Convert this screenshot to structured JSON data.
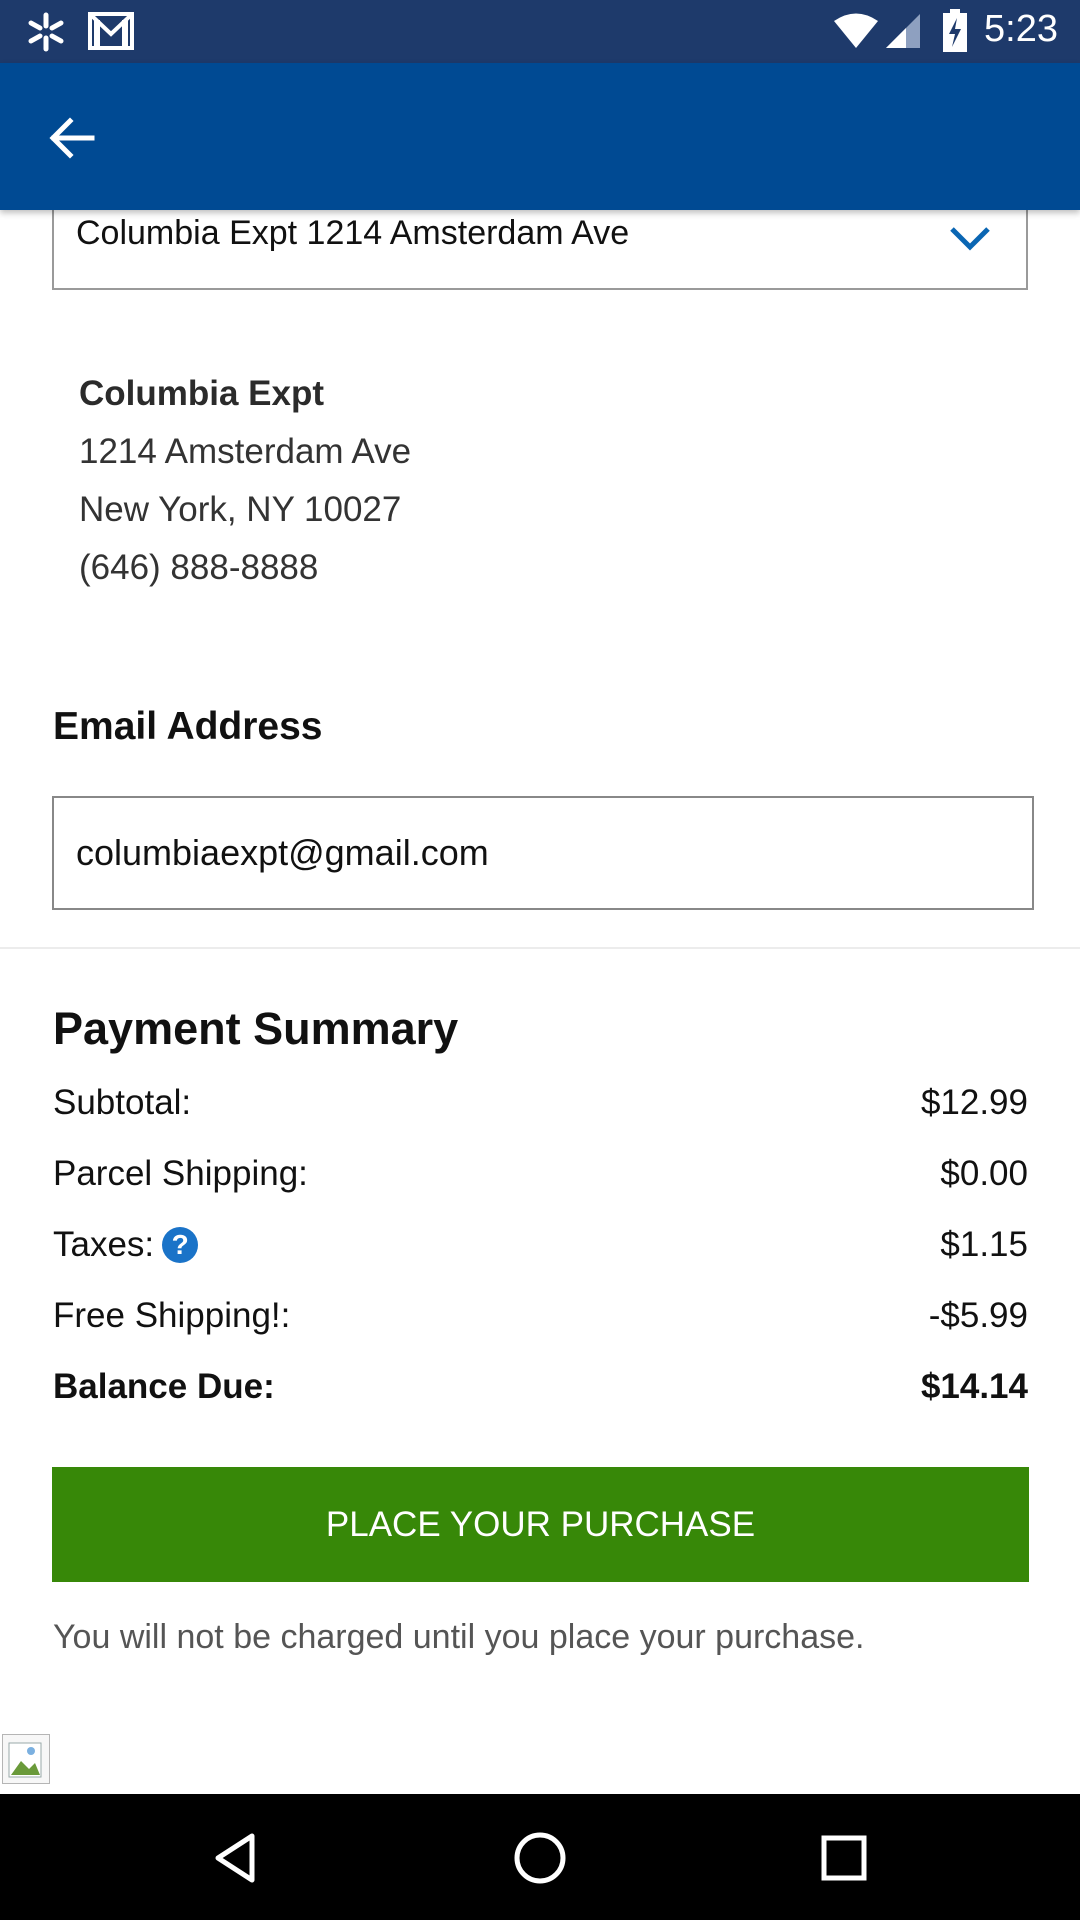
{
  "status_bar": {
    "time": "5:23",
    "left_icons": [
      "walmart-spark-icon",
      "gmail-icon"
    ],
    "right_icons": [
      "wifi-icon",
      "cell-signal-icon",
      "battery-charging-icon"
    ]
  },
  "app_bar": {
    "color": "#004a93",
    "back_icon": "arrow-left-icon"
  },
  "address_select": {
    "value": "Columbia Expt 1214 Amsterdam Ave",
    "icon": "chevron-down-icon"
  },
  "address": {
    "name": "Columbia Expt",
    "street": "1214 Amsterdam Ave",
    "city_state_zip": "New York, NY 10027",
    "phone": "(646) 888-8888"
  },
  "email": {
    "label": "Email Address",
    "value": "columbiaexpt@gmail.com"
  },
  "payment_summary": {
    "title": "Payment Summary",
    "rows": [
      {
        "label": "Subtotal:",
        "value": "$12.99"
      },
      {
        "label": "Parcel Shipping:",
        "value": "$0.00"
      },
      {
        "label": "Taxes:",
        "value": "$1.15",
        "help_icon": "question-circle-icon"
      },
      {
        "label": "Free Shipping!:",
        "value": "-$5.99"
      }
    ],
    "total": {
      "label": "Balance Due:",
      "value": "$14.14"
    }
  },
  "purchase_button": {
    "label": "PLACE YOUR PURCHASE",
    "color": "#378808"
  },
  "charge_note": "You will not be charged until you place your purchase.",
  "nav_bar": {
    "icons": [
      "back-triangle-icon",
      "home-circle-icon",
      "recents-square-icon"
    ]
  }
}
